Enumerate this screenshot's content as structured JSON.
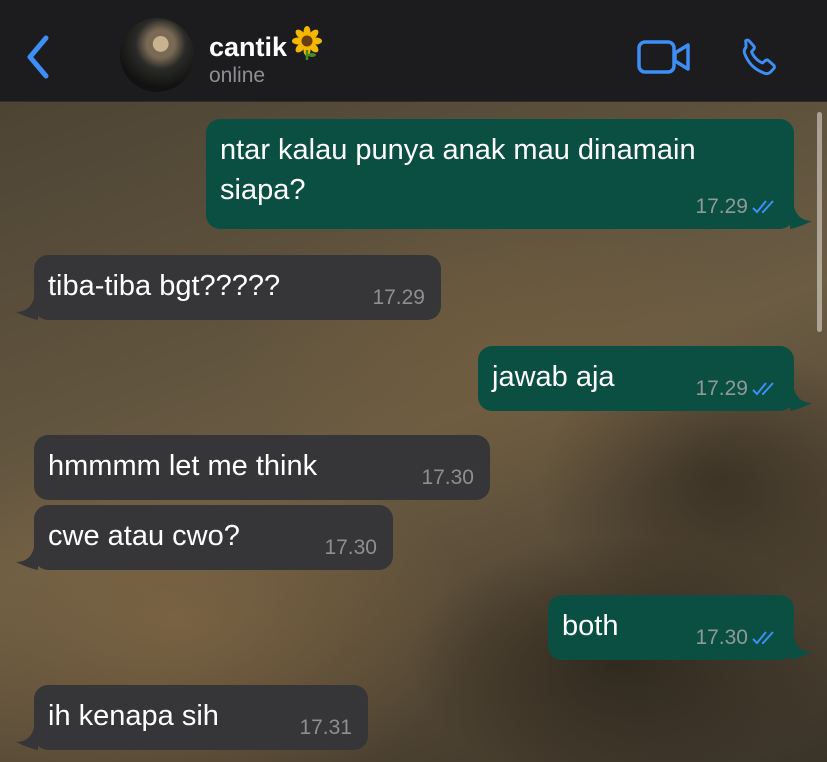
{
  "header": {
    "contact_name": "cantik",
    "status": "online",
    "colors": {
      "accent": "#3d8ff5",
      "background": "#1c1c1e"
    }
  },
  "icons": [
    "chevron-left-icon",
    "sunflower-emoji-icon",
    "video-camera-icon",
    "phone-icon",
    "double-check-icon"
  ],
  "messages": [
    {
      "direction": "out",
      "text": "ntar kalau punya anak mau dinamain siapa?",
      "time": "17.29",
      "read": true
    },
    {
      "direction": "in",
      "text": "tiba-tiba bgt?????",
      "time": "17.29"
    },
    {
      "direction": "out",
      "text": "jawab aja",
      "time": "17.29",
      "read": true
    },
    {
      "direction": "in",
      "text": "hmmmm let me think",
      "time": "17.30"
    },
    {
      "direction": "in",
      "text": "cwe atau cwo?",
      "time": "17.30"
    },
    {
      "direction": "out",
      "text": "both",
      "time": "17.30",
      "read": true
    },
    {
      "direction": "in",
      "text": "ih kenapa sih",
      "time": "17.31"
    }
  ],
  "colors": {
    "outgoing_bubble": "#0b4f43",
    "incoming_bubble": "#363638",
    "read_ticks": "#3d8ff5"
  }
}
